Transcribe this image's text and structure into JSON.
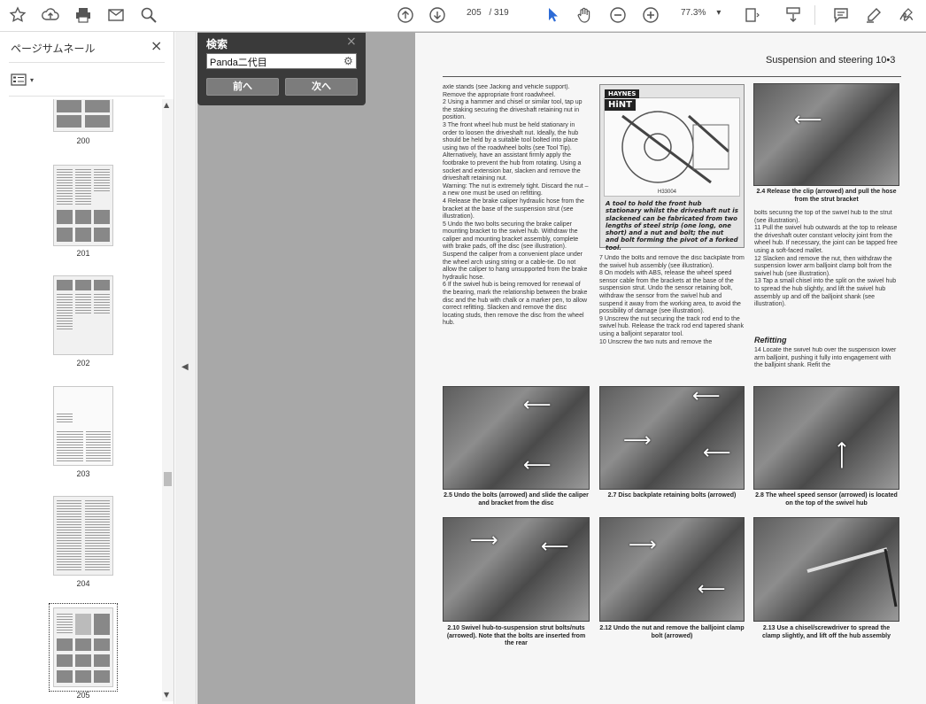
{
  "toolbar": {
    "page_current": "205",
    "page_total": "/ 319",
    "zoom": "77.3%",
    "icons": [
      "star-icon",
      "upload-icon",
      "print-icon",
      "mail-icon",
      "search-zoom-icon",
      "page-up-icon",
      "page-down-icon",
      "select-arrow-icon",
      "hand-icon",
      "zoom-out-icon",
      "zoom-in-icon",
      "fit-page-icon",
      "scroll-mode-icon",
      "comment-icon",
      "highlight-icon",
      "sign-icon"
    ]
  },
  "left_panel": {
    "title": "ページサムネール",
    "close": "×",
    "thumbnails": [
      {
        "label": "200"
      },
      {
        "label": "201"
      },
      {
        "label": "202"
      },
      {
        "label": "203"
      },
      {
        "label": "204"
      },
      {
        "label": "205",
        "selected": true
      }
    ]
  },
  "search": {
    "title": "検索",
    "close": "×",
    "query": "Panda二代目",
    "prev_label": "前へ",
    "next_label": "次へ"
  },
  "document": {
    "header": "Suspension and steering  10•3",
    "hint_label": "HAYNES",
    "hint_logo": "HiNT",
    "hint_figure_id": "H33004",
    "hint_caption": "A tool to hold the front hub stationary whilst the driveshaft nut is slackened can be fabricated from two lengths of steel strip (one long, one short) and a nut and bolt; the nut and bolt forming the pivot of a forked tool.",
    "col1_text": "axle stands (see Jacking and vehicle support). Remove the appropriate front roadwheel.\n2 Using a hammer and chisel or similar tool, tap up the staking securing the driveshaft retaining nut in position.\n3 The front wheel hub must be held stationary in order to loosen the driveshaft nut. Ideally, the hub should be held by a suitable tool bolted into place using two of the roadwheel bolts (see Tool Tip). Alternatively, have an assistant firmly apply the footbrake to prevent the hub from rotating. Using a socket and extension bar, slacken and remove the driveshaft retaining nut.\nWarning: The nut is extremely tight. Discard the nut – a new one must be used on refitting.\n4 Release the brake caliper hydraulic hose from the bracket at the base of the suspension strut (see illustration).\n5 Undo the two bolts securing the brake caliper mounting bracket to the swivel hub. Withdraw the caliper and mounting bracket assembly, complete with brake pads, off the disc (see illustration). Suspend the caliper from a convenient place under the wheel arch using string or a cable-tie. Do not allow the caliper to hang unsupported from the brake hydraulic hose.\n6 If the swivel hub is being removed for renewal of the bearing, mark the relationship between the brake disc and the hub with chalk or a marker pen, to allow correct refitting. Slacken and remove the disc locating studs, then remove the disc from the wheel hub.",
    "col2_text": "7 Undo the bolts and remove the disc backplate from the swivel hub assembly (see illustration).\n8 On models with ABS, release the wheel speed sensor cable from the brackets at the base of the suspension strut. Undo the sensor retaining bolt, withdraw the sensor from the swivel hub and suspend it away from the working area, to avoid the possibility of damage (see illustration).\n9 Unscrew the nut securing the track rod end to the swivel hub. Release the track rod end tapered shank using a balljoint separator tool.\n10 Unscrew the two nuts and remove the",
    "col3_text": "bolts securing the top of the swivel hub to the strut (see illustration).\n11 Pull the swivel hub outwards at the top to release the driveshaft outer constant velocity joint from the wheel hub. If necessary, the joint can be tapped free using a soft-faced mallet.\n12 Slacken and remove the nut, then withdraw the suspension lower arm balljoint clamp bolt from the swivel hub (see illustration).\n13 Tap a small chisel into the split on the swivel hub to spread the hub slightly, and lift the swivel hub assembly up and off the balljoint shank (see illustration).",
    "refitting_heading": "Refitting",
    "col3b_text": "14 Locate the swivel hub over the suspension lower arm balljoint, pushing it fully into engagement with the balljoint shank. Refit the",
    "captions": {
      "c24": "2.4 Release the clip (arrowed) and pull the hose from the strut bracket",
      "c25": "2.5 Undo the bolts (arrowed) and slide the caliper and bracket from the disc",
      "c27": "2.7 Disc backplate retaining bolts (arrowed)",
      "c28": "2.8 The wheel speed sensor (arrowed) is located on the top of the swivel hub",
      "c210": "2.10 Swivel hub-to-suspension strut bolts/nuts (arrowed). Note that the bolts are inserted from the rear",
      "c212": "2.12 Undo the nut and remove the balljoint clamp bolt (arrowed)",
      "c213": "2.13 Use a chisel/screwdriver to spread the clamp slightly, and lift off the hub assembly"
    }
  }
}
